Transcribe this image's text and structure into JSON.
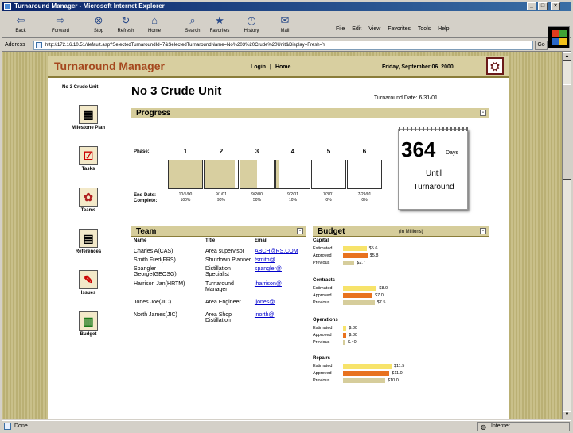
{
  "window": {
    "title": "Turnaround Manager - Microsoft Internet Explorer"
  },
  "toolbar": {
    "buttons": [
      {
        "label": "Back",
        "icon": "back-arrow-icon"
      },
      {
        "label": "Forward",
        "icon": "forward-arrow-icon"
      },
      {
        "label": "Stop",
        "icon": "stop-icon"
      },
      {
        "label": "Refresh",
        "icon": "refresh-icon"
      },
      {
        "label": "Home",
        "icon": "home-icon"
      },
      {
        "label": "Search",
        "icon": "search-icon"
      },
      {
        "label": "Favorites",
        "icon": "favorites-icon"
      },
      {
        "label": "History",
        "icon": "history-icon"
      },
      {
        "label": "Mail",
        "icon": "mail-icon"
      }
    ],
    "menu": [
      "File",
      "Edit",
      "View",
      "Favorites",
      "Tools",
      "Help"
    ]
  },
  "address": {
    "label": "Address",
    "url": "http://172.16.10.51/default.asp?SelectedTurnaroundId=7&SelectedTurnaroundName=No%203%20Crude%20Unit&Display=Fresh=Y",
    "go": "Go"
  },
  "status": {
    "left": "Done",
    "zone": "Internet"
  },
  "app": {
    "title": "Turnaround Manager",
    "login": "Login",
    "sep": "|",
    "home": "Home",
    "date": "Friday, September 06, 2000"
  },
  "nav": {
    "unit": "No 3 Crude Unit",
    "items": [
      "Milestone Plan",
      "Tasks",
      "Teams",
      "References",
      "Issues",
      "Budget"
    ]
  },
  "main": {
    "title": "No 3 Crude Unit",
    "turnaround_date": "Turnaround Date: 6/31/01"
  },
  "progress": {
    "header": "Progress",
    "phase_label": "Phase:",
    "end_label": "End Date:",
    "complete_label": "Complete:",
    "phases": [
      {
        "num": "1",
        "end": "10/1/00",
        "complete": "100%",
        "fill": 1.0
      },
      {
        "num": "2",
        "end": "9/1/01",
        "complete": "90%",
        "fill": 0.9
      },
      {
        "num": "3",
        "end": "9/2/00",
        "complete": "50%",
        "fill": 0.5
      },
      {
        "num": "4",
        "end": "9/2/01",
        "complete": "10%",
        "fill": 0.1
      },
      {
        "num": "5",
        "end": "7/3/01",
        "complete": "0%",
        "fill": 0.0
      },
      {
        "num": "6",
        "end": "7/29/01",
        "complete": "0%",
        "fill": 0.0
      }
    ],
    "countdown": {
      "number": "364",
      "unit": "Days",
      "until": "Until",
      "event": "Turnaround"
    }
  },
  "team": {
    "header": "Team",
    "columns": [
      "Name",
      "Title",
      "Email"
    ],
    "rows": [
      {
        "name": "Charles A(CAS)",
        "title": "Area supervisor",
        "email": "ABCH@RS.COM"
      },
      {
        "name": "Smith Fred(FRS)",
        "title": "Shutdown Planner",
        "email": "fsmith@"
      },
      {
        "name": "Spangler George(GEOSG)",
        "title": "Distillation Specialist",
        "email": "spangler@"
      },
      {
        "name": "Harrison Jan(HRTM)",
        "title": "Turnaround Manager",
        "email": "jharrison@"
      },
      {
        "name": "Jones Joe(JIC)",
        "title": "Area Engineer",
        "email": "jjones@"
      },
      {
        "name": "North James(JIC)",
        "title": "Area Shop Distillation",
        "email": "jnorth@"
      }
    ]
  },
  "budget": {
    "header": "Budget",
    "subheader": "(In Millions)",
    "row_labels": [
      "Estimated",
      "Approved",
      "Previous"
    ],
    "colors": {
      "estimated": "#f7e36a",
      "approved": "#e8721e",
      "previous": "#d6cd9b"
    },
    "groups": [
      {
        "name": "Capital",
        "values": [
          "$5.6",
          "$5.8",
          "$2.7"
        ],
        "amounts": [
          5.6,
          5.8,
          2.7
        ]
      },
      {
        "name": "Contracts",
        "values": [
          "$8.0",
          "$7.0",
          "$7.5"
        ],
        "amounts": [
          8.0,
          7.0,
          7.5
        ]
      },
      {
        "name": "Operations",
        "values": [
          "$.80",
          "$.80",
          "$.40"
        ],
        "amounts": [
          0.8,
          0.8,
          0.4
        ]
      },
      {
        "name": "Repairs",
        "values": [
          "$11.5",
          "$11.0",
          "$10.0"
        ],
        "amounts": [
          11.5,
          11.0,
          10.0
        ]
      }
    ]
  }
}
